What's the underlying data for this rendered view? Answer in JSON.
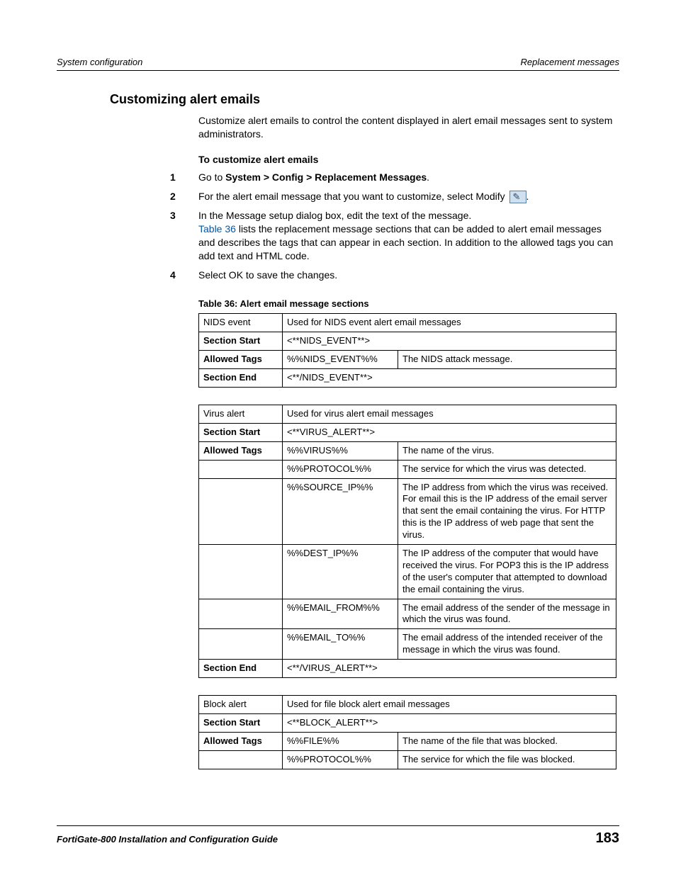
{
  "header": {
    "left": "System configuration",
    "right": "Replacement messages"
  },
  "heading": "Customizing alert emails",
  "intro": "Customize alert emails to control the content displayed in alert email messages sent to system administrators.",
  "sub_head": "To customize alert emails",
  "steps": {
    "s1_a": "Go to ",
    "s1_b": "System > Config > Replacement Messages",
    "s1_c": ".",
    "s2": "For the alert email message that you want to customize, select Modify ",
    "s3": "In the Message setup dialog box, edit the text of the message.",
    "s3b_link": "Table 36",
    "s3b_rest": " lists the replacement message sections that can be added to alert email messages and describes the tags that can appear in each section. In addition to the allowed tags you can add text and HTML code.",
    "s4": "Select OK to save the changes."
  },
  "table_caption": "Table 36: Alert email message sections",
  "labels": {
    "section_start": "Section Start",
    "allowed_tags": "Allowed Tags",
    "section_end": "Section End"
  },
  "t1": {
    "title": "NIDS event",
    "desc": "Used for NIDS event alert email messages",
    "start": "<**NIDS_EVENT**>",
    "tag1": "%%NIDS_EVENT%%",
    "tag1d": "The NIDS attack message.",
    "end": "<**/NIDS_EVENT**>"
  },
  "t2": {
    "title": "Virus alert",
    "desc": "Used for virus alert email messages",
    "start": "<**VIRUS_ALERT**>",
    "r1t": "%%VIRUS%%",
    "r1d": "The name of the virus.",
    "r2t": "%%PROTOCOL%%",
    "r2d": "The service for which the virus was detected.",
    "r3t": "%%SOURCE_IP%%",
    "r3d": "The IP address from which the virus was received. For email this is the IP address of the email server that sent the email containing the virus. For HTTP this is the IP address of web page that sent the virus.",
    "r4t": "%%DEST_IP%%",
    "r4d": "The IP address of the computer that would have received the virus. For POP3 this is the IP address of the user's computer that attempted to download the email containing the virus.",
    "r5t": "%%EMAIL_FROM%%",
    "r5d": "The email address of the sender of the message in which the virus was found.",
    "r6t": "%%EMAIL_TO%%",
    "r6d": "The email address of the intended receiver of the message in which the virus was found.",
    "end": "<**/VIRUS_ALERT**>"
  },
  "t3": {
    "title": "Block alert",
    "desc": "Used for file block alert email messages",
    "start": "<**BLOCK_ALERT**>",
    "r1t": "%%FILE%%",
    "r1d": "The name of the file that was blocked.",
    "r2t": "%%PROTOCOL%%",
    "r2d": "The service for which the file was blocked."
  },
  "footer": {
    "left": "FortiGate-800 Installation and Configuration Guide",
    "right": "183"
  }
}
